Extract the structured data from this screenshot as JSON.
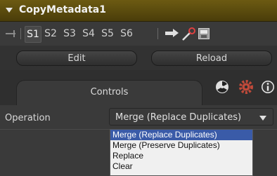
{
  "header": {
    "title": "CopyMetadata1"
  },
  "toolbar": {
    "slots": [
      "S1",
      "S2",
      "S3",
      "S4",
      "S5",
      "S6"
    ],
    "active_slot": "S1"
  },
  "buttons": {
    "edit_label": "Edit",
    "reload_label": "Reload"
  },
  "tabs": {
    "controls_label": "Controls"
  },
  "controls": {
    "operation_label": "Operation",
    "operation_value": "Merge (Replace Duplicates)"
  },
  "dropdown": {
    "options": [
      "Merge (Replace Duplicates)",
      "Merge (Preserve Duplicates)",
      "Replace",
      "Clear"
    ],
    "selected_index": 0
  },
  "colors": {
    "header_bg": "#5a4a0e",
    "panel_bg": "#3a3a3a",
    "selection": "#3a5ba8"
  }
}
